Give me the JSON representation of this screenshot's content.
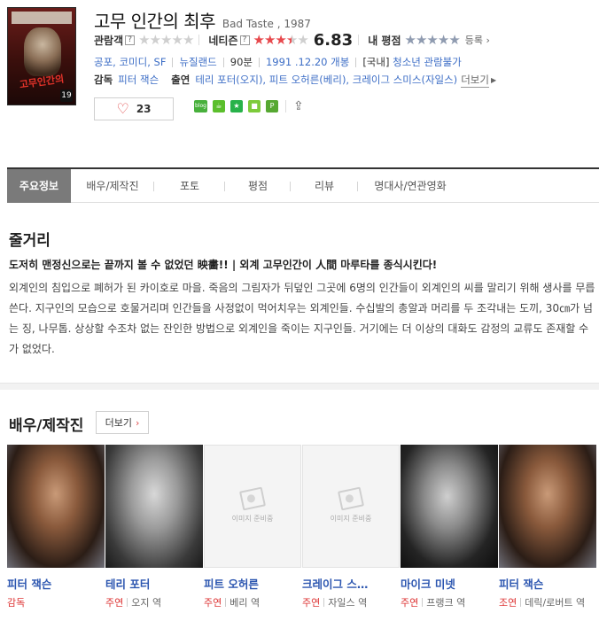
{
  "movie": {
    "title": "고무 인간의 최후",
    "subtitle": "Bad Taste , 1987",
    "poster_title": "고무인간의",
    "poster_chip": "19"
  },
  "ratings": {
    "audience_label": "관람객",
    "netizen_label": "네티즌",
    "netizen_score": "6.83",
    "my_label": "내 평점",
    "register_label": "등록",
    "qmark": "?",
    "audience_stars": 0,
    "netizen_stars": 3.5,
    "stars_out_of": 5
  },
  "info": {
    "genres": "공포, 코미디, SF",
    "country": "뉴질랜드",
    "runtime": "90분",
    "release": "1991 .12.20 개봉",
    "grade_prefix": "[국내]",
    "grade": "청소년 관람불가"
  },
  "crew": {
    "director_label": "감독",
    "director": "피터 잭슨",
    "cast_label": "출연",
    "cast_text": "테리 포터(오지), 피트 오허른(베리), 크레이그 스미스(자일스)",
    "more": "더보기"
  },
  "like": {
    "count": "23"
  },
  "share": {
    "icons": [
      "blog-icon",
      "cafe-icon",
      "band-icon",
      "me-icon",
      "post-icon",
      "share-out-icon"
    ],
    "blog_text": "blog"
  },
  "tabs": [
    {
      "label": "주요정보"
    },
    {
      "label": "배우/제작진"
    },
    {
      "label": "포토"
    },
    {
      "label": "평점"
    },
    {
      "label": "리뷰"
    },
    {
      "label": "명대사/연관영화"
    }
  ],
  "synopsis": {
    "title": "줄거리",
    "headline": "도저히 맨정신으로는 끝까지 볼 수 없었던 映畵!! | 외계 고무인간이 人間 마루타를 종식시킨다!",
    "body": "외계인의 침입으로 폐허가 된 카이호로 마을. 죽음의 그림자가 뒤덮인 그곳에 6명의 인간들이 외계인의 씨를 말리기 위해 생사를 무릅쓴다. 지구인의 모습으로 호물거리며 인간들을 사정없이 먹어치우는 외계인들. 수십발의 총알과 머리를 두 조각내는 도끼, 30㎝가 넘는 징, 나무톱. 상상할 수조차 없는 잔인한 방법으로 외계인을 죽이는 지구인들. 거기에는 더 이상의 대화도 감정의 교류도 존재할 수가 없었다."
  },
  "cast_section": {
    "title": "배우/제작진",
    "more": "더보기",
    "noimage_text": "이미지 준비중",
    "people": [
      {
        "name": "피터 잭슨",
        "role_kind": "감독",
        "role": ""
      },
      {
        "name": "테리 포터",
        "role_kind": "주연",
        "role": "오지 역"
      },
      {
        "name": "피트 오허른",
        "role_kind": "주연",
        "role": "베리 역"
      },
      {
        "name": "크레이그 스…",
        "role_kind": "주연",
        "role": "자일스 역"
      },
      {
        "name": "마이크 미넷",
        "role_kind": "주연",
        "role": "프랭크 역"
      },
      {
        "name": "피터 잭슨",
        "role_kind": "조연",
        "role": "데릭/로버트 역"
      }
    ]
  },
  "colors": {
    "accent_red": "#e7484c",
    "link_blue": "#3d6ec6",
    "tab_active": "#7a7a7a"
  }
}
